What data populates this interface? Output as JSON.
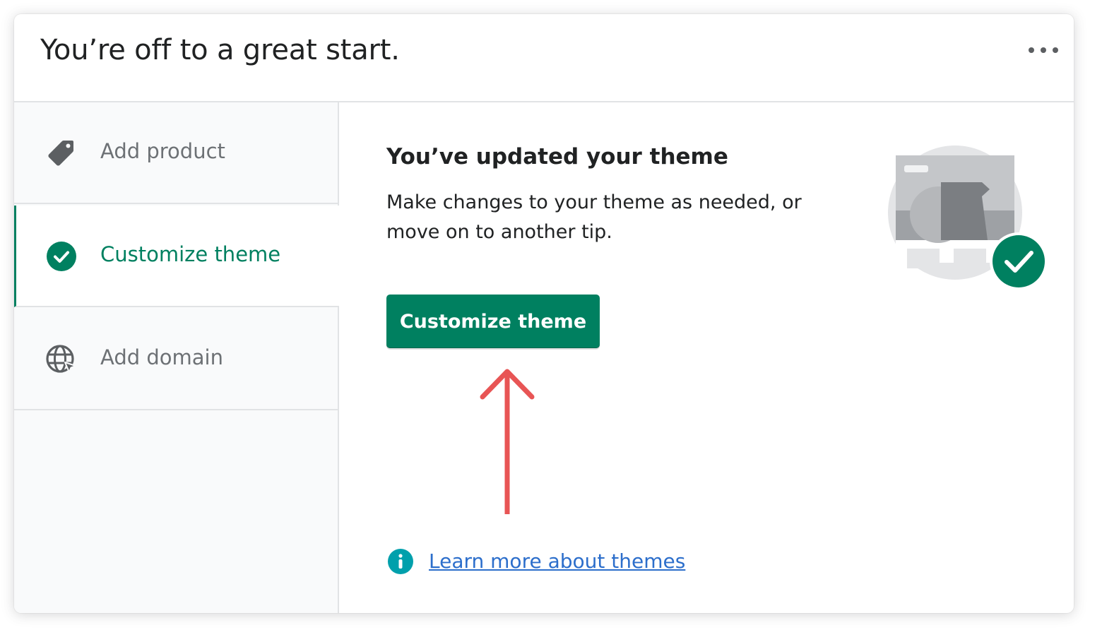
{
  "header": {
    "title": "You’re off to a great start."
  },
  "sidebar": {
    "items": [
      {
        "label": "Add product",
        "icon": "tag-icon",
        "active": false
      },
      {
        "label": "Customize theme",
        "icon": "checkmark-circle-icon",
        "active": true
      },
      {
        "label": "Add domain",
        "icon": "globe-icon",
        "active": false
      }
    ]
  },
  "content": {
    "title": "You’ve updated your theme",
    "description": "Make changes to your theme as needed, or move on to another tip.",
    "button_label": "Customize theme",
    "learn_more_link": "Learn more about themes"
  },
  "colors": {
    "brand_green": "#008060",
    "link_blue": "#2c6ecb",
    "info_teal": "#00a0ac",
    "annotation_arrow": "#e85555",
    "muted_text": "#6d7175"
  }
}
